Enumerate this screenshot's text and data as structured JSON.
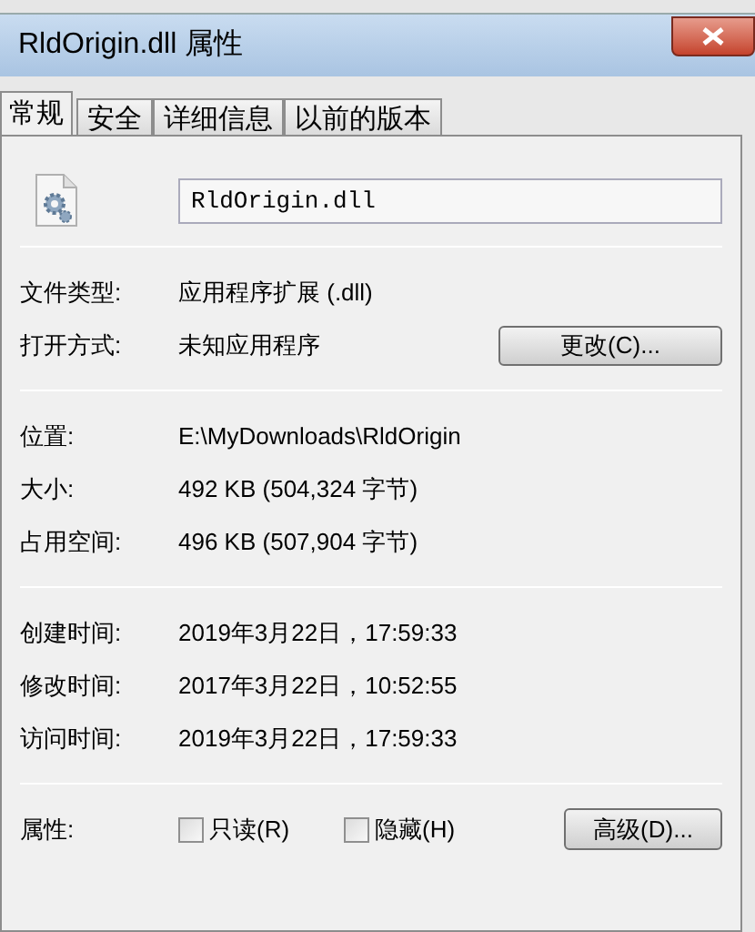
{
  "window": {
    "title": "RldOrigin.dll 属性"
  },
  "tabs": [
    {
      "label": "常规",
      "selected": true
    },
    {
      "label": "安全",
      "selected": false
    },
    {
      "label": "详细信息",
      "selected": false
    },
    {
      "label": "以前的版本",
      "selected": false
    }
  ],
  "file_name": {
    "value": "RldOrigin.dll"
  },
  "type_section": [
    {
      "label": "文件类型:",
      "value": "应用程序扩展 (.dll)"
    },
    {
      "label": "打开方式:",
      "value": "未知应用程序",
      "button": "更改(C)..."
    }
  ],
  "location_section": [
    {
      "label": "位置:",
      "value": "E:\\MyDownloads\\RldOrigin"
    },
    {
      "label": "大小:",
      "value": "492 KB (504,324 字节)"
    },
    {
      "label": "占用空间:",
      "value": "496 KB (507,904 字节)"
    }
  ],
  "time_section": [
    {
      "label": "创建时间:",
      "value": "2019年3月22日，17:59:33"
    },
    {
      "label": "修改时间:",
      "value": "2017年3月22日，10:52:55"
    },
    {
      "label": "访问时间:",
      "value": "2019年3月22日，17:59:33"
    }
  ],
  "attributes": {
    "label": "属性:",
    "checkboxes": [
      {
        "label": "只读(R)",
        "checked": false
      },
      {
        "label": "隐藏(H)",
        "checked": false
      }
    ],
    "button": "高级(D)..."
  }
}
